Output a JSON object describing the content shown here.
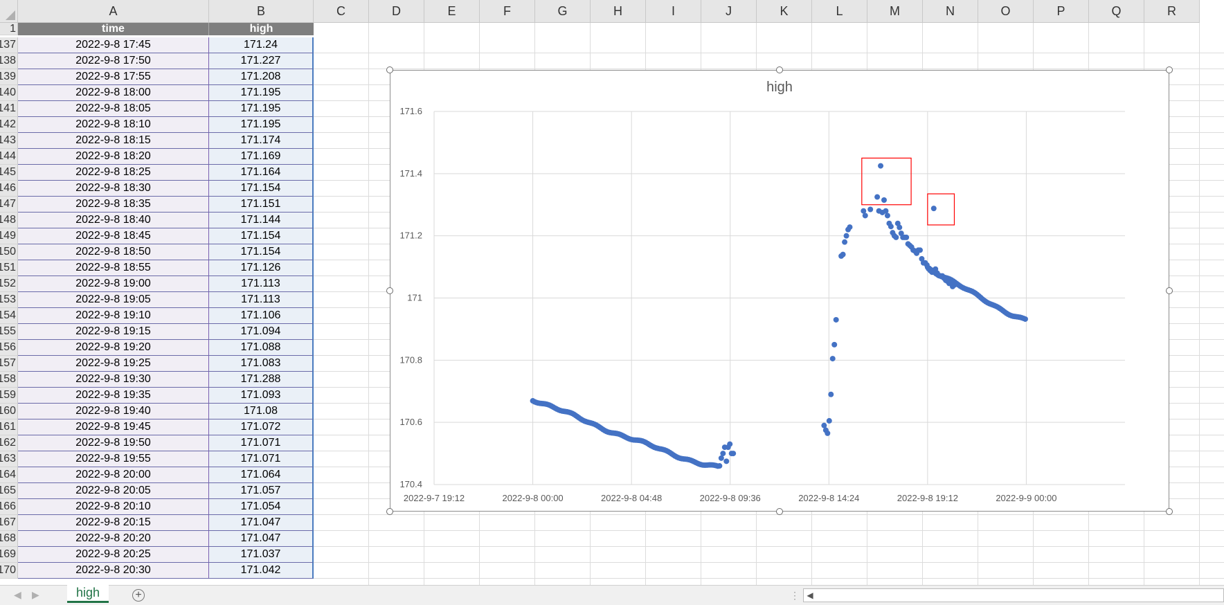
{
  "columns": [
    "A",
    "B",
    "C",
    "D",
    "E",
    "F",
    "G",
    "H",
    "I",
    "J",
    "K",
    "L",
    "M",
    "N",
    "O",
    "P",
    "Q",
    "R"
  ],
  "header_row": {
    "row_number": "1",
    "time_header": "time",
    "high_header": "high"
  },
  "rows": [
    {
      "num": "137",
      "time": "2022-9-8 17:45",
      "high": "171.24"
    },
    {
      "num": "138",
      "time": "2022-9-8 17:50",
      "high": "171.227"
    },
    {
      "num": "139",
      "time": "2022-9-8 17:55",
      "high": "171.208"
    },
    {
      "num": "140",
      "time": "2022-9-8 18:00",
      "high": "171.195"
    },
    {
      "num": "141",
      "time": "2022-9-8 18:05",
      "high": "171.195"
    },
    {
      "num": "142",
      "time": "2022-9-8 18:10",
      "high": "171.195"
    },
    {
      "num": "143",
      "time": "2022-9-8 18:15",
      "high": "171.174"
    },
    {
      "num": "144",
      "time": "2022-9-8 18:20",
      "high": "171.169"
    },
    {
      "num": "145",
      "time": "2022-9-8 18:25",
      "high": "171.164"
    },
    {
      "num": "146",
      "time": "2022-9-8 18:30",
      "high": "171.154"
    },
    {
      "num": "147",
      "time": "2022-9-8 18:35",
      "high": "171.151"
    },
    {
      "num": "148",
      "time": "2022-9-8 18:40",
      "high": "171.144"
    },
    {
      "num": "149",
      "time": "2022-9-8 18:45",
      "high": "171.154"
    },
    {
      "num": "150",
      "time": "2022-9-8 18:50",
      "high": "171.154"
    },
    {
      "num": "151",
      "time": "2022-9-8 18:55",
      "high": "171.126"
    },
    {
      "num": "152",
      "time": "2022-9-8 19:00",
      "high": "171.113"
    },
    {
      "num": "153",
      "time": "2022-9-8 19:05",
      "high": "171.113"
    },
    {
      "num": "154",
      "time": "2022-9-8 19:10",
      "high": "171.106"
    },
    {
      "num": "155",
      "time": "2022-9-8 19:15",
      "high": "171.094"
    },
    {
      "num": "156",
      "time": "2022-9-8 19:20",
      "high": "171.088"
    },
    {
      "num": "157",
      "time": "2022-9-8 19:25",
      "high": "171.083"
    },
    {
      "num": "158",
      "time": "2022-9-8 19:30",
      "high": "171.288"
    },
    {
      "num": "159",
      "time": "2022-9-8 19:35",
      "high": "171.093"
    },
    {
      "num": "160",
      "time": "2022-9-8 19:40",
      "high": "171.08"
    },
    {
      "num": "161",
      "time": "2022-9-8 19:45",
      "high": "171.072"
    },
    {
      "num": "162",
      "time": "2022-9-8 19:50",
      "high": "171.071"
    },
    {
      "num": "163",
      "time": "2022-9-8 19:55",
      "high": "171.071"
    },
    {
      "num": "164",
      "time": "2022-9-8 20:00",
      "high": "171.064"
    },
    {
      "num": "165",
      "time": "2022-9-8 20:05",
      "high": "171.057"
    },
    {
      "num": "166",
      "time": "2022-9-8 20:10",
      "high": "171.054"
    },
    {
      "num": "167",
      "time": "2022-9-8 20:15",
      "high": "171.047"
    },
    {
      "num": "168",
      "time": "2022-9-8 20:20",
      "high": "171.047"
    },
    {
      "num": "169",
      "time": "2022-9-8 20:25",
      "high": "171.037"
    },
    {
      "num": "170",
      "time": "2022-9-8 20:30",
      "high": "171.042"
    }
  ],
  "sheet_tab": {
    "label": "high",
    "color": "#217346"
  },
  "chart_data": {
    "type": "scatter",
    "title": "high",
    "xlabel": "",
    "ylabel": "",
    "ylim": [
      170.4,
      171.6
    ],
    "yticks": [
      "170.4",
      "170.6",
      "170.8",
      "171",
      "171.2",
      "171.4",
      "171.6"
    ],
    "xlim": [
      "2022-9-7 19:12",
      "2022-9-9 04:48"
    ],
    "xticks": [
      "2022-9-7 19:12",
      "2022-9-8 00:00",
      "2022-9-8 04:48",
      "2022-9-8 09:36",
      "2022-9-8 14:24",
      "2022-9-8 19:12",
      "2022-9-9 00:00"
    ],
    "grid": true,
    "marker_color": "#4472c4",
    "highlight_color": "#ff0000",
    "highlight_boxes": [
      {
        "time_from": "2022-9-8 16:00",
        "time_to": "2022-9-8 18:24",
        "high_from": 171.3,
        "high_to": 171.45
      },
      {
        "time_from": "2022-9-8 19:12",
        "time_to": "2022-9-8 20:30",
        "high_from": 171.235,
        "high_to": 171.335
      }
    ],
    "segments": [
      {
        "from": "2022-9-8 00:00",
        "to": "2022-9-8 09:00",
        "high_from": 170.675,
        "high_to": 170.455
      },
      {
        "from": "2022-9-8 19:12",
        "to": "2022-9-9 00:00",
        "high_from": 171.1,
        "high_to": 170.93
      }
    ],
    "points": [
      [
        "2022-9-8 09:05",
        170.46
      ],
      [
        "2022-9-8 09:10",
        170.485
      ],
      [
        "2022-9-8 09:15",
        170.5
      ],
      [
        "2022-9-8 09:20",
        170.52
      ],
      [
        "2022-9-8 09:25",
        170.475
      ],
      [
        "2022-9-8 09:30",
        170.52
      ],
      [
        "2022-9-8 09:35",
        170.53
      ],
      [
        "2022-9-8 09:40",
        170.5
      ],
      [
        "2022-9-8 09:45",
        170.5
      ],
      [
        "2022-9-8 14:10",
        170.59
      ],
      [
        "2022-9-8 14:15",
        170.575
      ],
      [
        "2022-9-8 14:20",
        170.565
      ],
      [
        "2022-9-8 14:25",
        170.605
      ],
      [
        "2022-9-8 14:30",
        170.69
      ],
      [
        "2022-9-8 14:35",
        170.805
      ],
      [
        "2022-9-8 14:40",
        170.85
      ],
      [
        "2022-9-8 14:45",
        170.93
      ],
      [
        "2022-9-8 15:00",
        171.135
      ],
      [
        "2022-9-8 15:05",
        171.14
      ],
      [
        "2022-9-8 15:10",
        171.18
      ],
      [
        "2022-9-8 15:15",
        171.2
      ],
      [
        "2022-9-8 15:20",
        171.22
      ],
      [
        "2022-9-8 15:25",
        171.228
      ],
      [
        "2022-9-8 16:05",
        171.28
      ],
      [
        "2022-9-8 16:10",
        171.265
      ],
      [
        "2022-9-8 16:25",
        171.285
      ],
      [
        "2022-9-8 16:45",
        171.325
      ],
      [
        "2022-9-8 16:50",
        171.28
      ],
      [
        "2022-9-8 16:55",
        171.425
      ],
      [
        "2022-9-8 17:00",
        171.275
      ],
      [
        "2022-9-8 17:05",
        171.315
      ],
      [
        "2022-9-8 17:10",
        171.28
      ],
      [
        "2022-9-8 17:15",
        171.265
      ],
      [
        "2022-9-8 17:20",
        171.24
      ],
      [
        "2022-9-8 17:25",
        171.23
      ],
      [
        "2022-9-8 17:30",
        171.21
      ],
      [
        "2022-9-8 17:35",
        171.2
      ],
      [
        "2022-9-8 17:40",
        171.195
      ],
      [
        "2022-9-8 17:45",
        171.24
      ],
      [
        "2022-9-8 17:50",
        171.227
      ],
      [
        "2022-9-8 17:55",
        171.208
      ],
      [
        "2022-9-8 18:00",
        171.195
      ],
      [
        "2022-9-8 18:05",
        171.195
      ],
      [
        "2022-9-8 18:10",
        171.195
      ],
      [
        "2022-9-8 18:15",
        171.174
      ],
      [
        "2022-9-8 18:20",
        171.169
      ],
      [
        "2022-9-8 18:25",
        171.164
      ],
      [
        "2022-9-8 18:30",
        171.154
      ],
      [
        "2022-9-8 18:35",
        171.151
      ],
      [
        "2022-9-8 18:40",
        171.144
      ],
      [
        "2022-9-8 18:45",
        171.154
      ],
      [
        "2022-9-8 18:50",
        171.154
      ],
      [
        "2022-9-8 18:55",
        171.126
      ],
      [
        "2022-9-8 19:00",
        171.113
      ],
      [
        "2022-9-8 19:05",
        171.113
      ],
      [
        "2022-9-8 19:10",
        171.106
      ],
      [
        "2022-9-8 19:15",
        171.094
      ],
      [
        "2022-9-8 19:20",
        171.088
      ],
      [
        "2022-9-8 19:25",
        171.083
      ],
      [
        "2022-9-8 19:30",
        171.288
      ],
      [
        "2022-9-8 19:35",
        171.093
      ],
      [
        "2022-9-8 19:40",
        171.08
      ],
      [
        "2022-9-8 19:45",
        171.072
      ],
      [
        "2022-9-8 19:50",
        171.071
      ],
      [
        "2022-9-8 19:55",
        171.071
      ],
      [
        "2022-9-8 20:00",
        171.064
      ],
      [
        "2022-9-8 20:05",
        171.057
      ],
      [
        "2022-9-8 20:10",
        171.054
      ],
      [
        "2022-9-8 20:15",
        171.047
      ],
      [
        "2022-9-8 20:20",
        171.047
      ],
      [
        "2022-9-8 20:25",
        171.037
      ],
      [
        "2022-9-8 20:30",
        171.042
      ]
    ]
  }
}
